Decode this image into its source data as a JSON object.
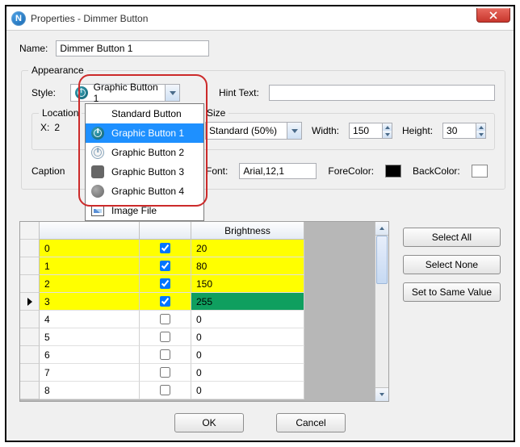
{
  "window": {
    "title": "Properties - Dimmer Button"
  },
  "name": {
    "label": "Name:",
    "value": "Dimmer Button 1"
  },
  "appearance": {
    "legend": "Appearance",
    "style": {
      "label": "Style:",
      "selected": "Graphic Button 1"
    },
    "dropdown": {
      "items": [
        "Standard Button",
        "Graphic Button 1",
        "Graphic Button 2",
        "Graphic Button 3",
        "Graphic Button 4",
        "Image File"
      ],
      "highlight_index": 1
    },
    "hint": {
      "label": "Hint Text:",
      "value": ""
    },
    "location": {
      "legend": "Location",
      "x_label": "X:",
      "x_value": "2"
    },
    "size": {
      "legend": "Size",
      "combo_value": "Standard   (50%)",
      "width_label": "Width:",
      "width_value": "150",
      "height_label": "Height:",
      "height_value": "30"
    },
    "caption_label": "Caption",
    "font": {
      "label": "Font:",
      "value": "Arial,12,1"
    },
    "forecolor": {
      "label": "ForeColor:",
      "hex": "#000000"
    },
    "backcolor": {
      "label": "BackColor:",
      "hex": "#ffffff"
    }
  },
  "grid": {
    "columns": [
      "",
      "",
      "Brightness"
    ],
    "rows": [
      {
        "idx": "0",
        "on": true,
        "brightness": "20",
        "selected": false
      },
      {
        "idx": "1",
        "on": true,
        "brightness": "80",
        "selected": false
      },
      {
        "idx": "2",
        "on": true,
        "brightness": "150",
        "selected": false
      },
      {
        "idx": "3",
        "on": true,
        "brightness": "255",
        "selected": true
      },
      {
        "idx": "4",
        "on": false,
        "brightness": "0",
        "selected": false
      },
      {
        "idx": "5",
        "on": false,
        "brightness": "0",
        "selected": false
      },
      {
        "idx": "6",
        "on": false,
        "brightness": "0",
        "selected": false
      },
      {
        "idx": "7",
        "on": false,
        "brightness": "0",
        "selected": false
      },
      {
        "idx": "8",
        "on": false,
        "brightness": "0",
        "selected": false
      }
    ]
  },
  "buttons": {
    "select_all": "Select All",
    "select_none": "Select None",
    "same_value": "Set to Same Value",
    "ok": "OK",
    "cancel": "Cancel"
  }
}
